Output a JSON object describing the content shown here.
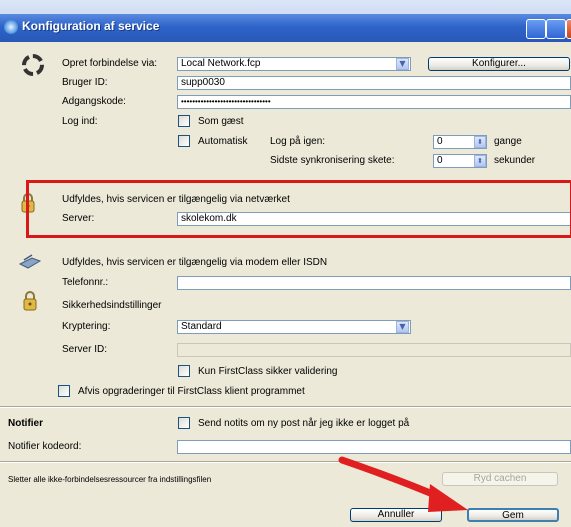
{
  "window": {
    "title": "Konfiguration af service"
  },
  "connection": {
    "via_label": "Opret forbindelse via:",
    "via_value": "Local Network.fcp",
    "configure_button": "Konfigurer...",
    "user_id_label": "Bruger ID:",
    "user_id_value": "supp0030",
    "password_label": "Adgangskode:",
    "password_value": "••••••••••••••••••••••••••••••••",
    "login_label": "Log ind:",
    "guest_label": "Som gæst",
    "auto_label": "Automatisk",
    "retry_label": "Log på igen:",
    "retry_value": "0",
    "retry_unit": "gange",
    "sync_label": "Sidste synkronisering skete:",
    "sync_value": "0",
    "sync_unit": "sekunder"
  },
  "network": {
    "heading": "Udfyldes, hvis servicen er tilgængelig via netværket",
    "server_label": "Server:",
    "server_value": "skolekom.dk"
  },
  "modem": {
    "heading": "Udfyldes, hvis servicen er tilgængelig via modem eller ISDN",
    "phone_label": "Telefonnr.:",
    "phone_value": ""
  },
  "security": {
    "heading": "Sikkerhedsindstillinger",
    "encryption_label": "Kryptering:",
    "encryption_value": "Standard",
    "server_id_label": "Server ID:",
    "server_id_value": "",
    "firstclass_only_label": "Kun FirstClass sikker validering",
    "reject_upgrades_label": "Afvis opgraderinger til FirstClass klient programmet"
  },
  "notifier": {
    "heading": "Notifier",
    "send_label": "Send notits om ny post når jeg ikke er logget på",
    "password_label": "Notifier kodeord:",
    "password_value": ""
  },
  "cache": {
    "text": "Sletter alle ikke-forbindelsesressourcer fra indstillingsfilen",
    "clear_button": "Ryd cachen"
  },
  "footer": {
    "cancel_button": "Annuller",
    "save_button": "Gem"
  },
  "colors": {
    "highlight": "#d91919",
    "arrow": "#e02020",
    "title_bar": "#2f64c9"
  }
}
